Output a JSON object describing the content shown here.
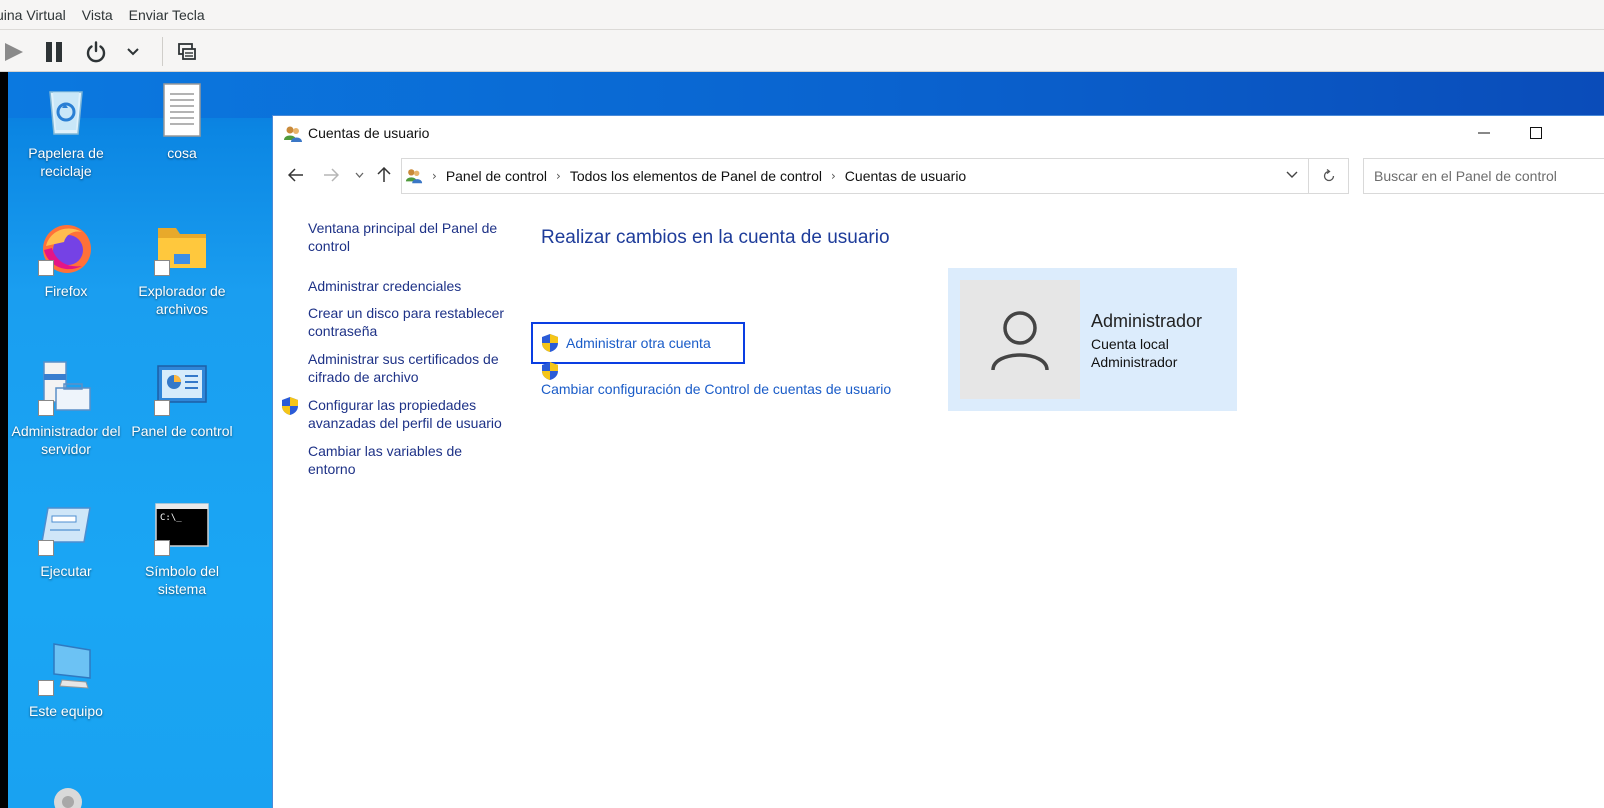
{
  "host": {
    "menu": [
      "uina Virtual",
      "Vista",
      "Enviar Tecla"
    ],
    "toolbar": {
      "play_icon": "play-icon",
      "pause_icon": "pause-icon",
      "power_icon": "power-icon",
      "dropdown_icon": "chevron-down-icon",
      "screens_icon": "screens-icon"
    }
  },
  "desktop": {
    "icons": [
      {
        "label": "Papelera de reciclaje",
        "icon": "recycle-bin-icon"
      },
      {
        "label": "cosa",
        "icon": "text-file-icon"
      },
      {
        "label": "Firefox",
        "icon": "firefox-icon"
      },
      {
        "label": "Explorador de archivos",
        "icon": "folder-icon"
      },
      {
        "label": "Administrador del servidor",
        "icon": "server-manager-icon"
      },
      {
        "label": "Panel de control",
        "icon": "control-panel-icon"
      },
      {
        "label": "Ejecutar",
        "icon": "run-icon"
      },
      {
        "label": "Símbolo del sistema",
        "icon": "cmd-icon"
      },
      {
        "label": "Este equipo",
        "icon": "computer-icon"
      }
    ]
  },
  "window": {
    "title": "Cuentas de usuario",
    "breadcrumb": [
      "Panel de control",
      "Todos los elementos de Panel de control",
      "Cuentas de usuario"
    ],
    "search_placeholder": "Buscar en el Panel de control",
    "left_links": [
      "Ventana principal del Panel de control",
      "Administrar credenciales",
      "Crear un disco para restablecer contraseña",
      "Administrar sus certificados de cifrado de archivo",
      "Configurar las propiedades avanzadas del perfil de usuario",
      "Cambiar las variables de entorno"
    ],
    "heading": "Realizar cambios en la cuenta de usuario",
    "link_other_account": "Administrar otra cuenta",
    "link_uac": "Cambiar configuración de Control de cuentas de usuario",
    "user": {
      "name": "Administrador",
      "type": "Cuenta local",
      "role": "Administrador"
    }
  },
  "colors": {
    "link": "#1a5cc8",
    "heading": "#1e3c9a",
    "task_link": "#1e3287",
    "focus_border": "#0a3ee2",
    "card_bg": "#dcecfc",
    "desktop_blue": "#1aa6f4"
  }
}
